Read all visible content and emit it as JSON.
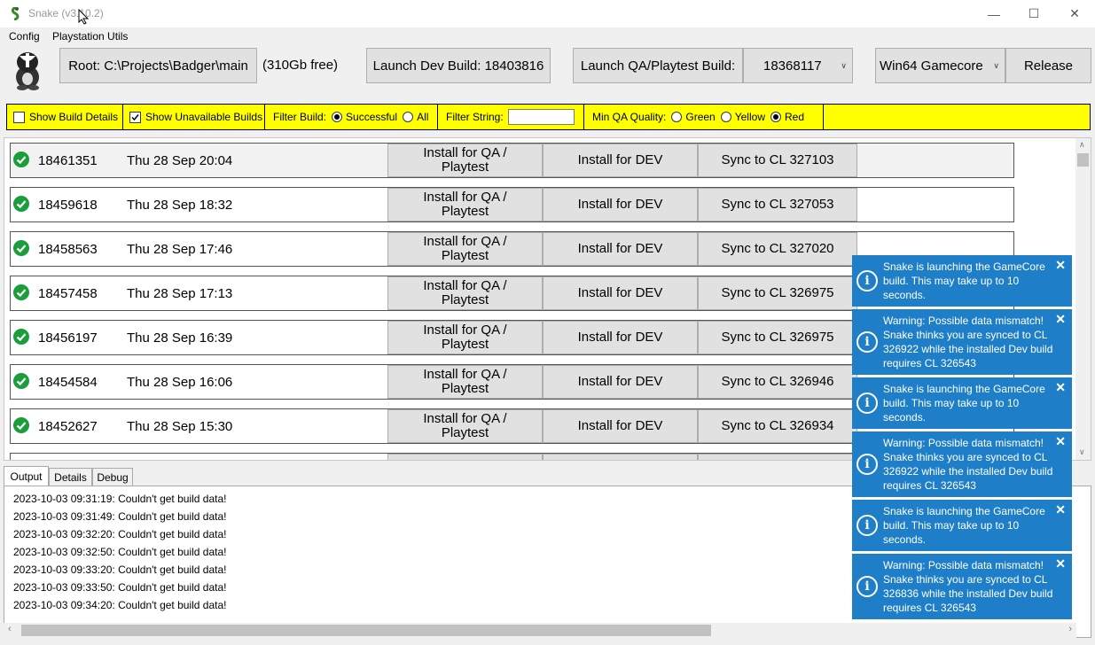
{
  "window": {
    "title": "Snake (v3.10.2)"
  },
  "menu": {
    "items": [
      "Config",
      "Playstation Utils"
    ]
  },
  "toolbar": {
    "root_label": "Root: C:\\Projects\\Badger\\main",
    "free_space": "(310Gb free)",
    "launch_dev_label": "Launch Dev Build: 18403816",
    "launch_qa_label": "Launch QA/Playtest Build:",
    "qa_build_value": "18368117",
    "platform_value": "Win64 Gamecore",
    "config_label": "Release"
  },
  "filters": {
    "show_build_details": {
      "label": "Show Build Details",
      "checked": false
    },
    "show_unavailable_builds": {
      "label": "Show Unavailable Builds",
      "checked": true
    },
    "filter_build_label": "Filter Build:",
    "successful_label": "Successful",
    "all_label": "All",
    "filter_string_label": "Filter String:",
    "filter_string_value": "",
    "min_qa_label": "Min QA Quality:",
    "green_label": "Green",
    "yellow_label": "Yellow",
    "red_label": "Red"
  },
  "builds": [
    {
      "number": "18461351",
      "date": "Thu 28 Sep 20:04",
      "install_qa": "Install for QA /\nPlaytest",
      "install_dev": "Install for DEV",
      "sync": "Sync to CL 327103"
    },
    {
      "number": "18459618",
      "date": "Thu 28 Sep 18:32",
      "install_qa": "Install for QA /\nPlaytest",
      "install_dev": "Install for DEV",
      "sync": "Sync to CL 327053"
    },
    {
      "number": "18458563",
      "date": "Thu 28 Sep 17:46",
      "install_qa": "Install for QA /\nPlaytest",
      "install_dev": "Install for DEV",
      "sync": "Sync to CL 327020"
    },
    {
      "number": "18457458",
      "date": "Thu 28 Sep 17:13",
      "install_qa": "Install for QA /\nPlaytest",
      "install_dev": "Install for DEV",
      "sync": "Sync to CL 326975"
    },
    {
      "number": "18456197",
      "date": "Thu 28 Sep 16:39",
      "install_qa": "Install for QA /\nPlaytest",
      "install_dev": "Install for DEV",
      "sync": "Sync to CL 326975"
    },
    {
      "number": "18454584",
      "date": "Thu 28 Sep 16:06",
      "install_qa": "Install for QA /\nPlaytest",
      "install_dev": "Install for DEV",
      "sync": "Sync to CL 326946"
    },
    {
      "number": "18452627",
      "date": "Thu 28 Sep 15:30",
      "install_qa": "Install for QA /\nPlaytest",
      "install_dev": "Install for DEV",
      "sync": "Sync to CL 326934"
    }
  ],
  "tabs": [
    "Output",
    "Details",
    "Debug"
  ],
  "log": [
    "2023-10-03 09:31:19: Couldn't get build data!",
    "2023-10-03 09:31:49: Couldn't get build data!",
    "2023-10-03 09:32:20: Couldn't get build data!",
    "2023-10-03 09:32:50: Couldn't get build data!",
    "2023-10-03 09:33:20: Couldn't get build data!",
    "2023-10-03 09:33:50: Couldn't get build data!",
    "2023-10-03 09:34:20: Couldn't get build data!"
  ],
  "notifications": [
    "Snake is launching the GameCore build. This may take up to 10 seconds.",
    "Warning: Possible data mismatch! Snake thinks you are synced to CL 326922 while the installed Dev build requires CL 326543",
    "Snake is launching the GameCore build. This may take up to 10 seconds.",
    "Warning: Possible data mismatch! Snake thinks you are synced to CL 326922 while the installed Dev build requires CL 326543",
    "Snake is launching the GameCore build. This may take up to 10 seconds.",
    "Warning: Possible data mismatch! Snake thinks you are synced to CL 326836 while the installed Dev build requires CL 326543"
  ],
  "colors": {
    "filter_bar": "#ffff00",
    "toast": "#1e7fc8",
    "ok_green": "#1a9e3a"
  }
}
